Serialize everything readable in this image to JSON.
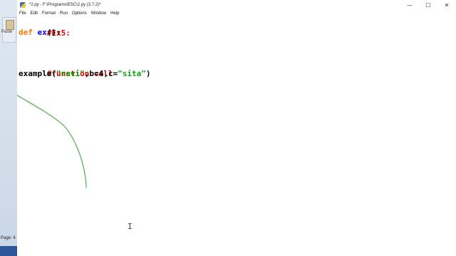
{
  "ghost": {
    "paste_label": "Paste",
    "page_label": "Page: 4"
  },
  "window": {
    "title": "*2.py - F:\\Programs\\ESC\\2.py (3.7.2)*",
    "controls": {
      "minimize": "—",
      "maximize": "☐",
      "close": "✕"
    }
  },
  "menu": [
    "File",
    "Edit",
    "Format",
    "Run",
    "Options",
    "Window",
    "Help"
  ],
  "code": {
    "line1": "#Ex5:",
    "line2_def": "def",
    "line2_name": "ex",
    "line2_rest": "():",
    "line3": "#function call",
    "line4_call": "example(",
    "line4_s1": "\"ravi\"",
    "line4_mid": ",b=4,c=",
    "line4_s2": "\"sita\"",
    "line4_end": ")"
  },
  "colors": {
    "keyword": "#ff7700",
    "definition": "#0000ff",
    "comment": "#dd0000",
    "string": "#00aa00",
    "ink": "#4caf50"
  }
}
